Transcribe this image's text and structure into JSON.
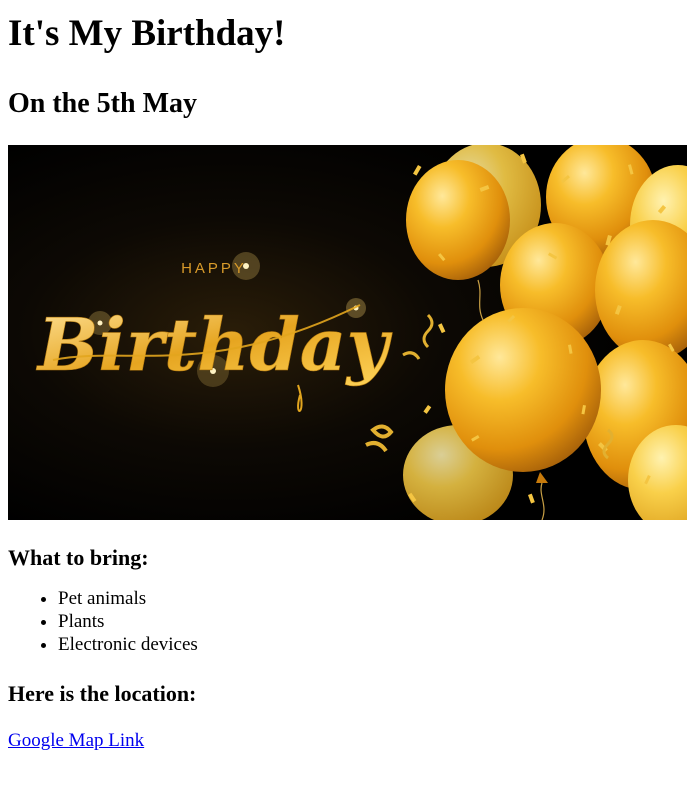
{
  "heading": "It's My Birthday!",
  "date_heading": "On the 5th May",
  "banner": {
    "happy_text": "HAPPY",
    "birthday_text": "Birthday",
    "colors": {
      "background": "#050403",
      "gold": "#f0b21a",
      "gold_dark": "#d48a0a",
      "gold_light": "#ffd860"
    }
  },
  "bring": {
    "title": "What to bring:",
    "items": [
      "Pet animals",
      "Plants",
      "Electronic devices"
    ]
  },
  "location": {
    "title": "Here is the location:",
    "link_text": "Google Map Link",
    "link_color": "#0000ee"
  }
}
